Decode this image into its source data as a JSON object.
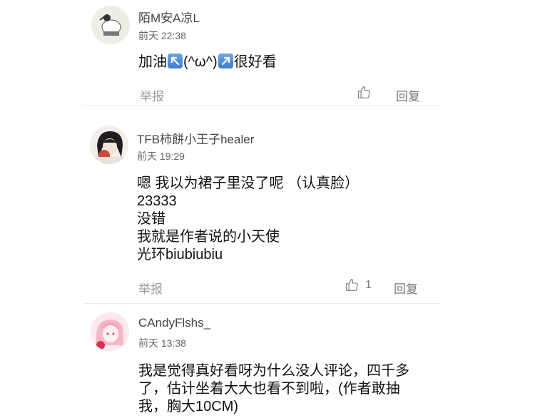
{
  "comments": [
    {
      "username": "陌M安A凉L",
      "time": "前天 22:38",
      "content_parts": [
        "加油",
        "(^ω^)",
        "很好看"
      ],
      "emoji_icons": [
        "arrow-up-left-icon",
        "arrow-up-right-icon"
      ],
      "report_label": "举报",
      "reply_label": "回复",
      "like_count": ""
    },
    {
      "username": "TFB柿餅小王子healer",
      "time": "前天 19:29",
      "content_lines": [
        "嗯 我以为裙子里没了呢 （认真脸）",
        "23333",
        "没错",
        "我就是作者说的小天使",
        "光环biubiubiu"
      ],
      "report_label": "举报",
      "reply_label": "回复",
      "like_count": "1"
    },
    {
      "username": "CAndyFlshs_",
      "time": "前天 13:38",
      "content_lines": [
        "我是觉得真好看呀为什么没人评论，四千多",
        "了，估计坐着大大也看不到啦，(作者敢抽",
        "我，胸大10CM)"
      ],
      "report_label": "",
      "reply_label": "",
      "like_count": ""
    }
  ],
  "colors": {
    "username": "#444444",
    "time": "#666666",
    "muted_action": "#9a9a9a",
    "divider": "#ececec"
  }
}
